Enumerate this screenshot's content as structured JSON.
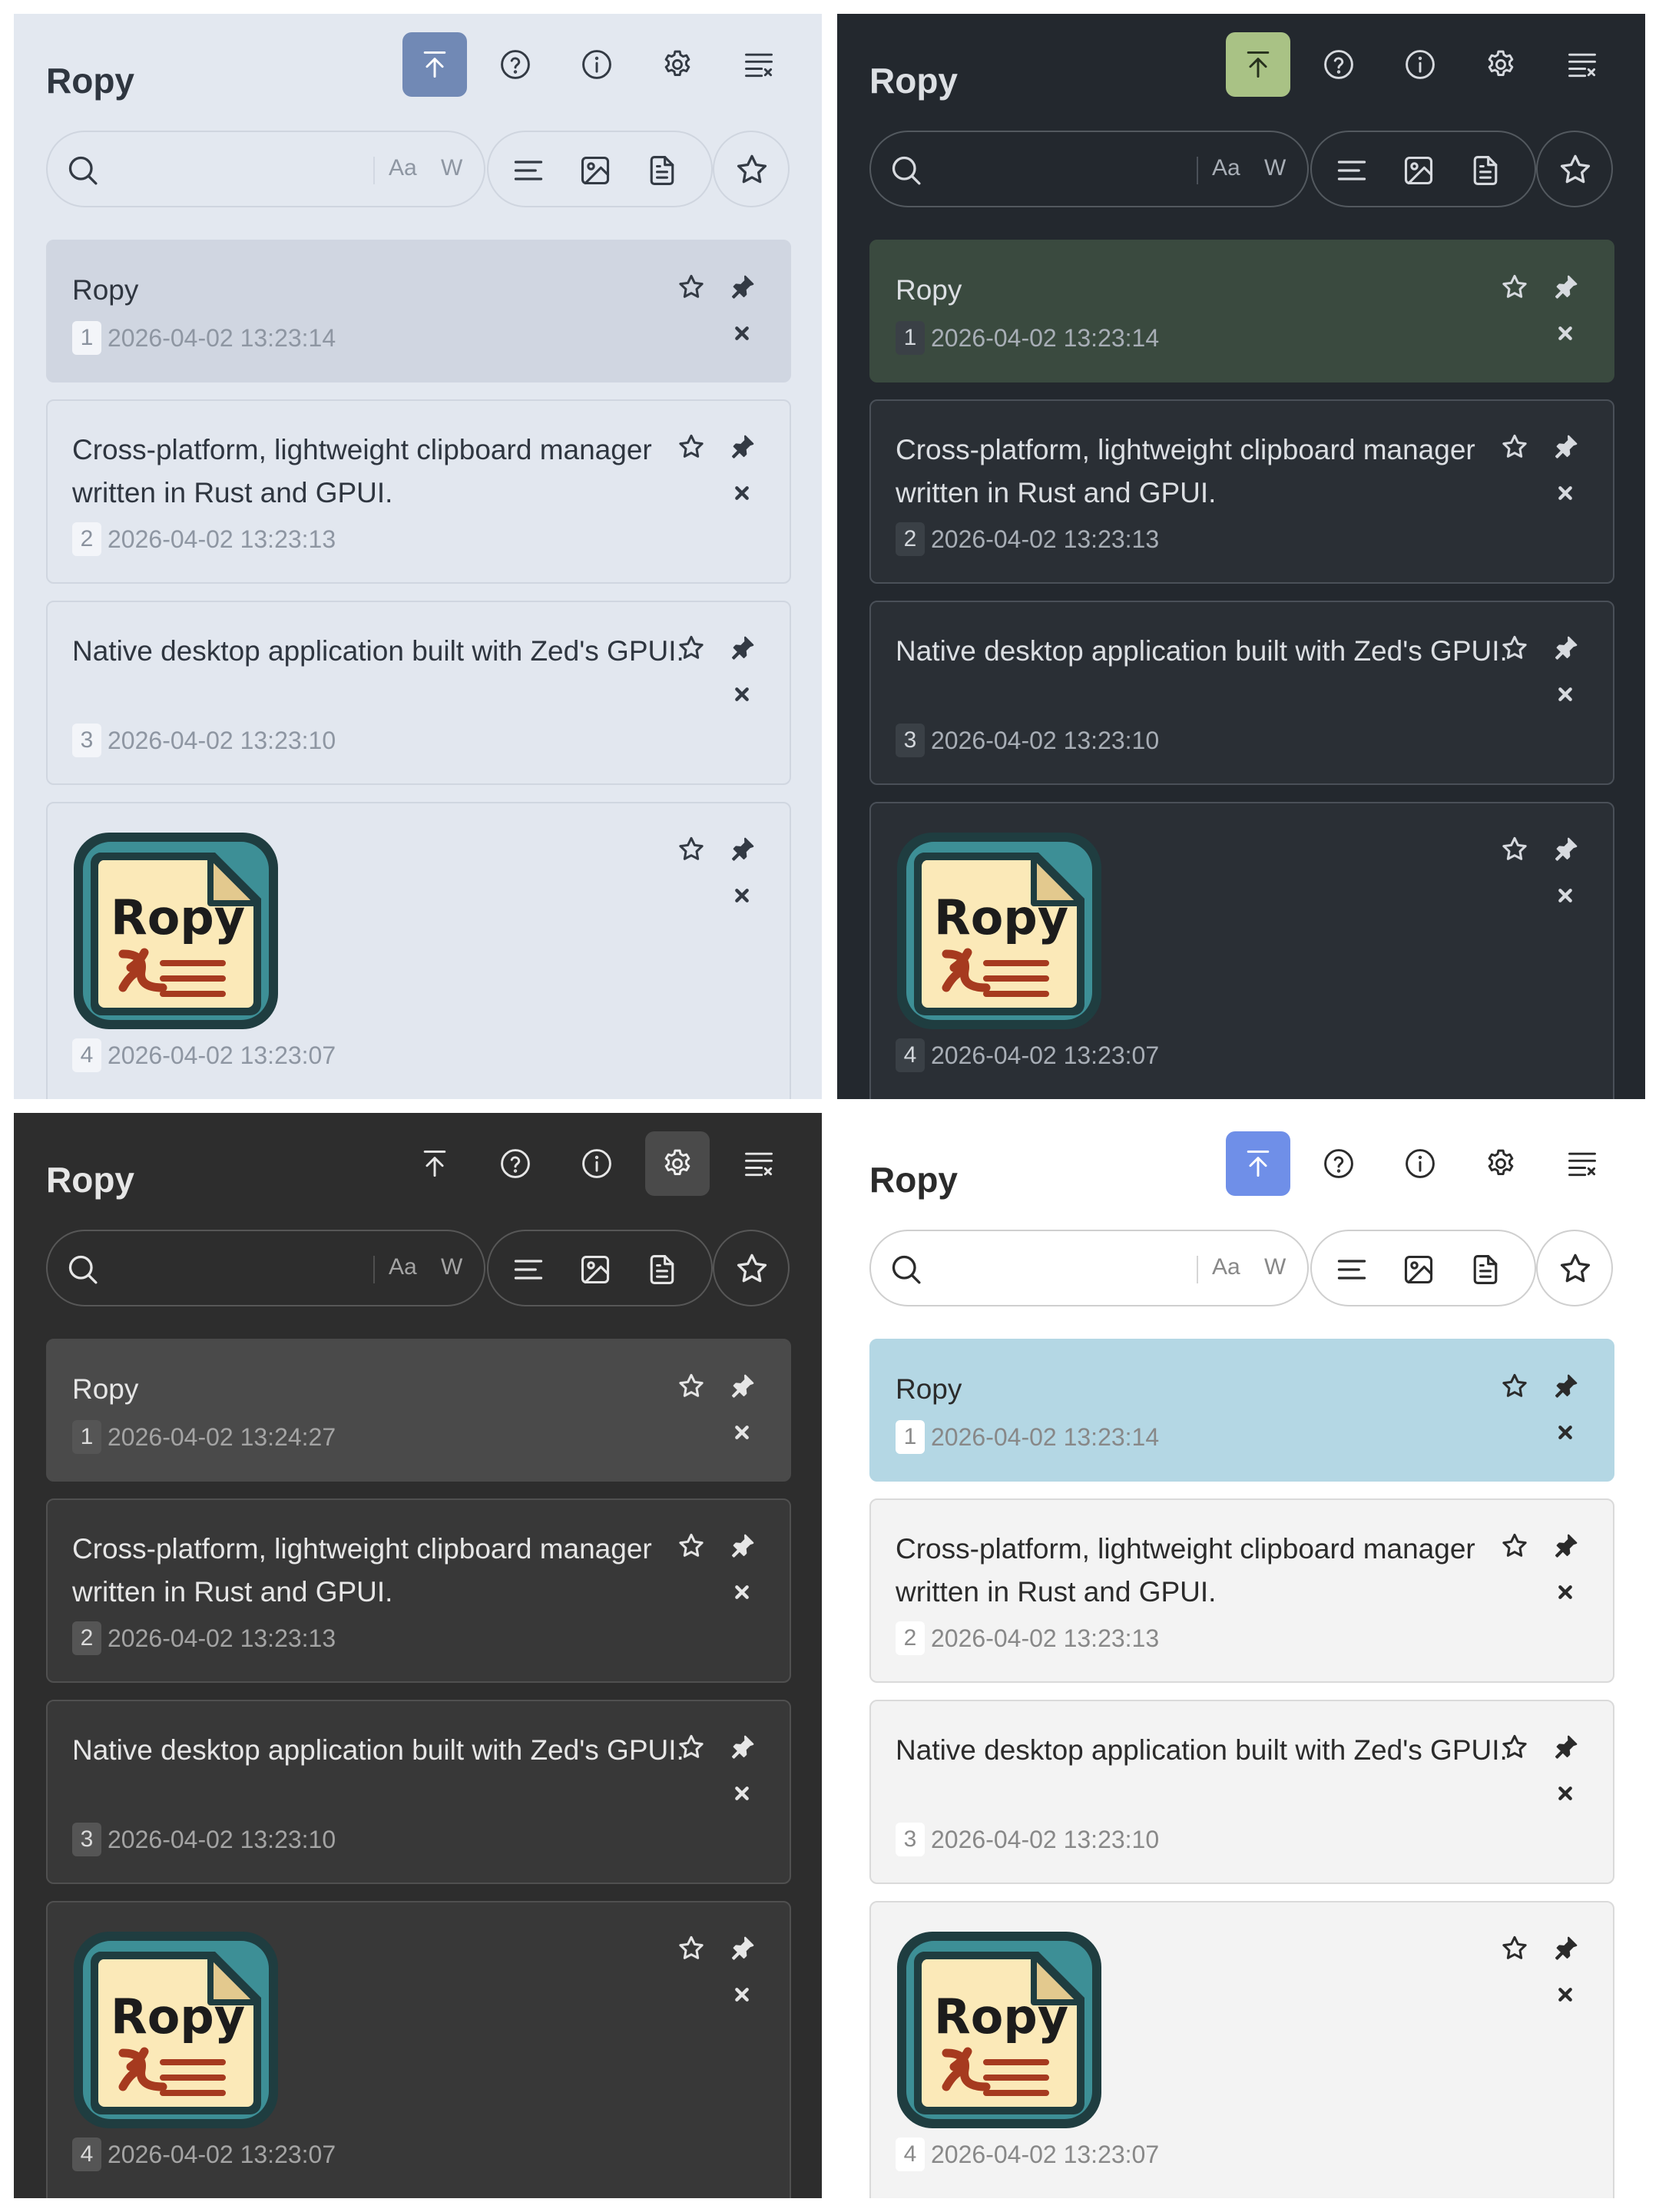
{
  "app": {
    "title": "Ropy",
    "logo_text": "Ropy"
  },
  "header": {
    "icons": [
      "arrow-up-to-line-icon",
      "help-circle-icon",
      "info-circle-icon",
      "gear-icon",
      "list-clear-icon"
    ]
  },
  "search": {
    "value": "",
    "case_label": "Aa",
    "word_label": "W",
    "icons": [
      "search-icon",
      "text-filter-icon",
      "image-filter-icon",
      "file-filter-icon",
      "star-icon"
    ]
  },
  "panels": [
    {
      "theme": "light-blue-gray",
      "active_header_button": "top",
      "items": [
        {
          "index": "1",
          "text": "Ropy",
          "timestamp": "2026-04-02 13:23:14"
        },
        {
          "index": "2",
          "text": "Cross-platform, lightweight clipboard manager written in Rust and GPUI.",
          "timestamp": "2026-04-02 13:23:13"
        },
        {
          "index": "3",
          "text": "Native desktop application built with Zed's GPUI.",
          "timestamp": "2026-04-02 13:23:10"
        },
        {
          "index": "4",
          "image": "ropy-app-icon",
          "timestamp": "2026-04-02 13:23:07"
        }
      ]
    },
    {
      "theme": "dark-green",
      "active_header_button": "top",
      "items": [
        {
          "index": "1",
          "text": "Ropy",
          "timestamp": "2026-04-02 13:23:14"
        },
        {
          "index": "2",
          "text": "Cross-platform, lightweight clipboard manager written in Rust and GPUI.",
          "timestamp": "2026-04-02 13:23:13"
        },
        {
          "index": "3",
          "text": "Native desktop application built with Zed's GPUI.",
          "timestamp": "2026-04-02 13:23:10"
        },
        {
          "index": "4",
          "image": "ropy-app-icon",
          "timestamp": "2026-04-02 13:23:07"
        }
      ]
    },
    {
      "theme": "dark-gray",
      "active_header_button": "settings",
      "items": [
        {
          "index": "1",
          "text": "Ropy",
          "timestamp": "2026-04-02 13:24:27"
        },
        {
          "index": "2",
          "text": "Cross-platform, lightweight clipboard manager written in Rust and GPUI.",
          "timestamp": "2026-04-02 13:23:13"
        },
        {
          "index": "3",
          "text": "Native desktop application built with Zed's GPUI.",
          "timestamp": "2026-04-02 13:23:10"
        },
        {
          "index": "4",
          "image": "ropy-app-icon",
          "timestamp": "2026-04-02 13:23:07"
        }
      ]
    },
    {
      "theme": "light",
      "active_header_button": "top",
      "items": [
        {
          "index": "1",
          "text": "Ropy",
          "timestamp": "2026-04-02 13:23:14"
        },
        {
          "index": "2",
          "text": "Cross-platform, lightweight clipboard manager written in Rust and GPUI.",
          "timestamp": "2026-04-02 13:23:13"
        },
        {
          "index": "3",
          "text": "Native desktop application built with Zed's GPUI.",
          "timestamp": "2026-04-02 13:23:10"
        },
        {
          "index": "4",
          "image": "ropy-app-icon",
          "timestamp": "2026-04-02 13:23:07"
        }
      ]
    }
  ],
  "themes": {
    "light-blue-gray": {
      "bg": "#e3e8f0",
      "fg": "#2f3640",
      "muted": "#8e96a2",
      "border": "#d2d8e2",
      "pill_border": "#cfd5df",
      "card_bg": "#e2e7ef",
      "card_border": "#d0d6e0",
      "selected_bg": "#d0d6e1",
      "selected_border": "#d0d6e1",
      "badge_bg": "#f3f5f9",
      "badge_fg": "#8a929e",
      "active_bg": "#7189b5",
      "active_fg": "#ffffff",
      "icon": "#333a44"
    },
    "dark-green": {
      "bg": "#23282e",
      "fg": "#dcdfe3",
      "muted": "#a8aeb6",
      "border": "#4a5058",
      "pill_border": "#53595f",
      "card_bg": "#2a2f35",
      "card_border": "#4a5058",
      "selected_bg": "#3a4a3f",
      "selected_border": "#3a4a3f",
      "badge_bg": "#3a4046",
      "badge_fg": "#d3d7dc",
      "active_bg": "#a9c285",
      "active_fg": "#26301c",
      "icon": "#d7dadf"
    },
    "dark-gray": {
      "bg": "#2d2d2d",
      "fg": "#e6e6e6",
      "muted": "#a4a4a4",
      "border": "#4f4f4f",
      "pill_border": "#575757",
      "card_bg": "#383838",
      "card_border": "#505050",
      "selected_bg": "#4a4a4a",
      "selected_border": "#4a4a4a",
      "badge_bg": "#555555",
      "badge_fg": "#dcdcdc",
      "active_bg": "#4a4a4a",
      "active_fg": "#eeeeee",
      "icon": "#e6e6e6"
    },
    "light": {
      "bg": "#ffffff",
      "fg": "#2b2b2b",
      "muted": "#888888",
      "border": "#d6d6d6",
      "pill_border": "#cfcfcf",
      "card_bg": "#f3f3f3",
      "card_border": "#dadada",
      "selected_bg": "#b4d7e4",
      "selected_border": "#b4d7e4",
      "badge_bg": "#ffffff",
      "badge_fg": "#8a8a8a",
      "active_bg": "#6f8fe8",
      "active_fg": "#ffffff",
      "icon": "#2b2b2b"
    }
  },
  "logo_colors": {
    "frame": "#1f3d40",
    "teal": "#3d8f96",
    "paper": "#fbe9b8",
    "fold": "#e3c98e",
    "mark": "#a63a1f"
  }
}
